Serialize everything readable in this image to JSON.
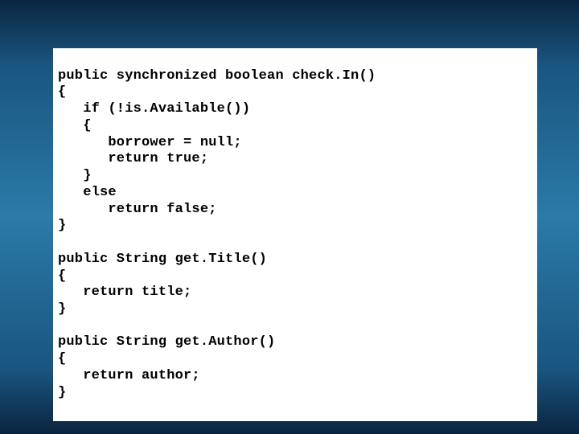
{
  "code": {
    "lines": [
      "public synchronized boolean check.In()",
      "{",
      "   if (!is.Available())",
      "   {",
      "      borrower = null;",
      "      return true;",
      "   }",
      "   else",
      "      return false;",
      "}",
      "",
      "public String get.Title()",
      "{",
      "   return title;",
      "}",
      "",
      "public String get.Author()",
      "{",
      "   return author;",
      "}"
    ]
  }
}
